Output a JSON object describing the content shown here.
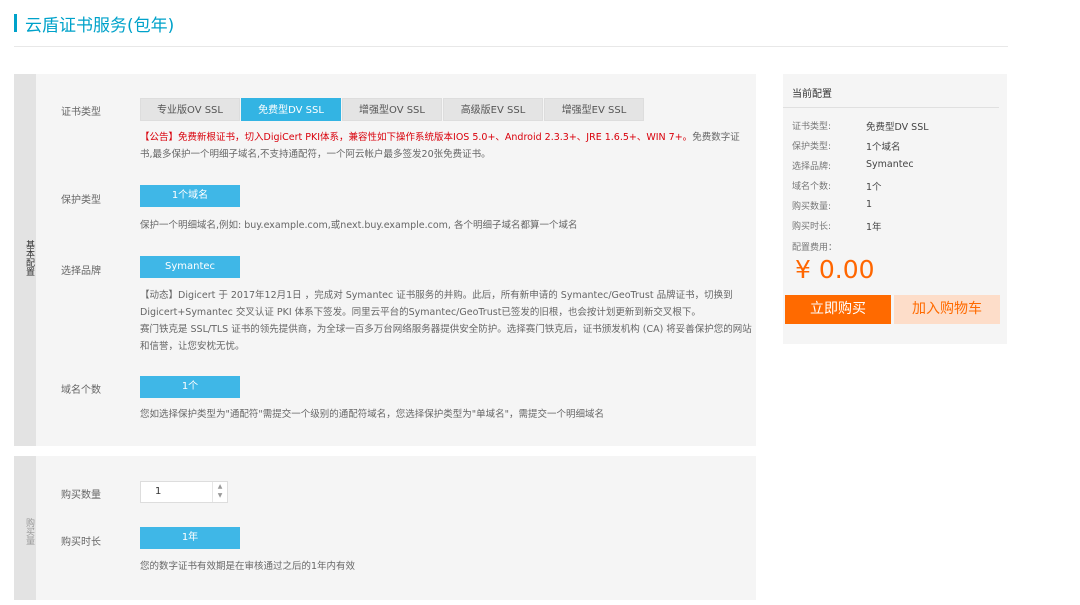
{
  "page_title": "云盾证书服务(包年)",
  "basic_section": {
    "side_label": "基本配置",
    "cert_type": {
      "label": "证书类型",
      "tabs": [
        "专业版OV SSL",
        "免费型DV SSL",
        "增强型OV SSL",
        "高级版EV SSL",
        "增强型EV SSL"
      ],
      "active_index": 1,
      "notice_red": "【公告】免费新根证书，切入DigiCert PKI体系，兼容性如下操作系统版本IOS 5.0+、Android 2.3.3+、JRE 1.6.5+、WIN 7+。",
      "notice_rest": "免费数字证书,最多保护一个明细子域名,不支持通配符，一个阿云帐户最多签发20张免费证书。"
    },
    "protect_type": {
      "label": "保护类型",
      "value": "1个域名",
      "desc": "保护一个明细域名,例如: buy.example.com,或next.buy.example.com, 各个明细子域名都算一个域名"
    },
    "brand": {
      "label": "选择品牌",
      "value": "Symantec",
      "desc1": "【动态】Digicert 于 2017年12月1日 ，完成对 Symantec 证书服务的并购。此后，所有新申请的 Symantec/GeoTrust 品牌证书，切换到 Digicert+Symantec 交叉认证 PKI 体系下签发。同里云平台的Symantec/GeoTrust已签发的旧根，也会按计划更新到新交叉根下。",
      "desc2": "赛门铁克是 SSL/TLS 证书的领先提供商，为全球一百多万台网络服务器提供安全防护。选择赛门铁克后，证书颁发机构 (CA) 将妥善保护您的网站和信誉，让您安枕无忧。"
    },
    "domain_count": {
      "label": "域名个数",
      "value": "1个",
      "desc": "您如选择保护类型为\"通配符\"需提交一个级别的通配符域名，您选择保护类型为\"单域名\"，需提交一个明细域名"
    }
  },
  "buy_section": {
    "side_label": "购买量",
    "quantity": {
      "label": "购买数量",
      "value": "1"
    },
    "duration": {
      "label": "购买时长",
      "value": "1年",
      "desc": "您的数字证书有效期是在审核通过之后的1年内有效"
    }
  },
  "summary": {
    "title": "当前配置",
    "rows": [
      {
        "label": "证书类型:",
        "value": "免费型DV SSL"
      },
      {
        "label": "保护类型:",
        "value": "1个域名"
      },
      {
        "label": "选择品牌:",
        "value": "Symantec"
      },
      {
        "label": "域名个数:",
        "value": "1个"
      },
      {
        "label": "购买数量:",
        "value": "1"
      },
      {
        "label": "购买时长:",
        "value": "1年"
      }
    ],
    "fee_label": "配置费用：",
    "price": "¥ 0.00",
    "buy_button": "立即购买",
    "cart_button": "加入购物车"
  },
  "colors": {
    "accent": "#33b4e3",
    "title": "#00a2ca",
    "notice_red": "#d9000b",
    "price": "#ff6600",
    "buy_button": "#ff6a00",
    "cart_button_bg": "#fdddc9"
  },
  "icons": {
    "stepper": "stepper-arrows-icon"
  }
}
